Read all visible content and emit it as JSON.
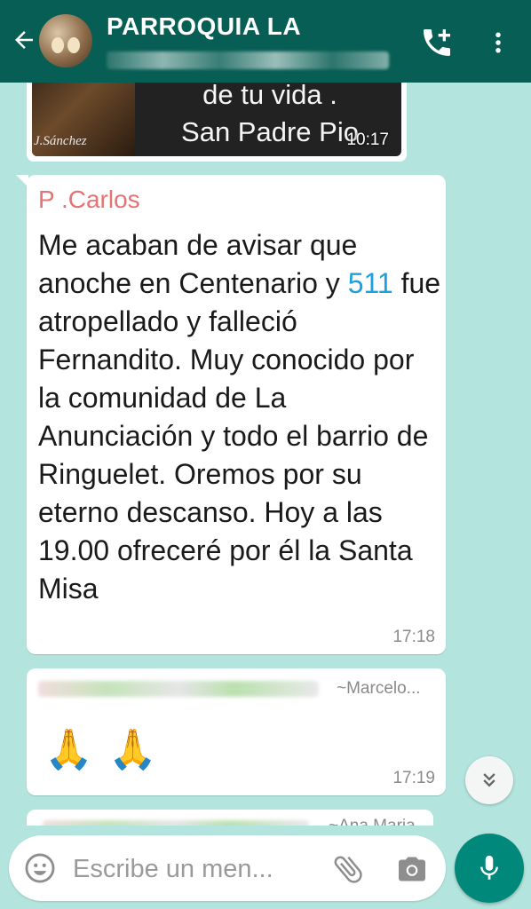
{
  "header": {
    "title": "PARROQUIA LA",
    "background": "#075e54"
  },
  "messages": {
    "image_message": {
      "caption_line1": "de tu vida .",
      "caption_line2": "San Padre Pio",
      "signature": "J.Sánchez",
      "time": "10:17"
    },
    "text_message": {
      "sender": "P .Carlos",
      "text_before_link": "Me acaban de avisar que anoche en Centenario y ",
      "link": "511",
      "text_after_link": " fue atropellado y falleció Fernandito. Muy conocido por la comunidad de La Anunciación y todo el barrio de Ringuelet. Oremos por su eterno descanso. Hoy a las 19.00 ofreceré por él la Santa Misa",
      "time": "17:18"
    },
    "emoji_message": {
      "sender_name": "~Marcelo...",
      "emoji1": "🙏",
      "emoji2": "🙏",
      "time": "17:19"
    },
    "partial_message": {
      "sender_name": "~Ana Maria"
    }
  },
  "composer": {
    "placeholder": "Escribe un men..."
  },
  "icons": {
    "back": "back-arrow-icon",
    "call": "add-call-icon",
    "menu": "more-vert-icon",
    "emoji": "emoji-icon",
    "attach": "paperclip-icon",
    "camera": "camera-icon",
    "mic": "mic-icon",
    "scroll": "double-chevron-down-icon"
  },
  "colors": {
    "chat_background": "#b3e5de",
    "sender_color": "#e57373",
    "link_color": "#1e9fe0",
    "accent": "#00897b"
  }
}
